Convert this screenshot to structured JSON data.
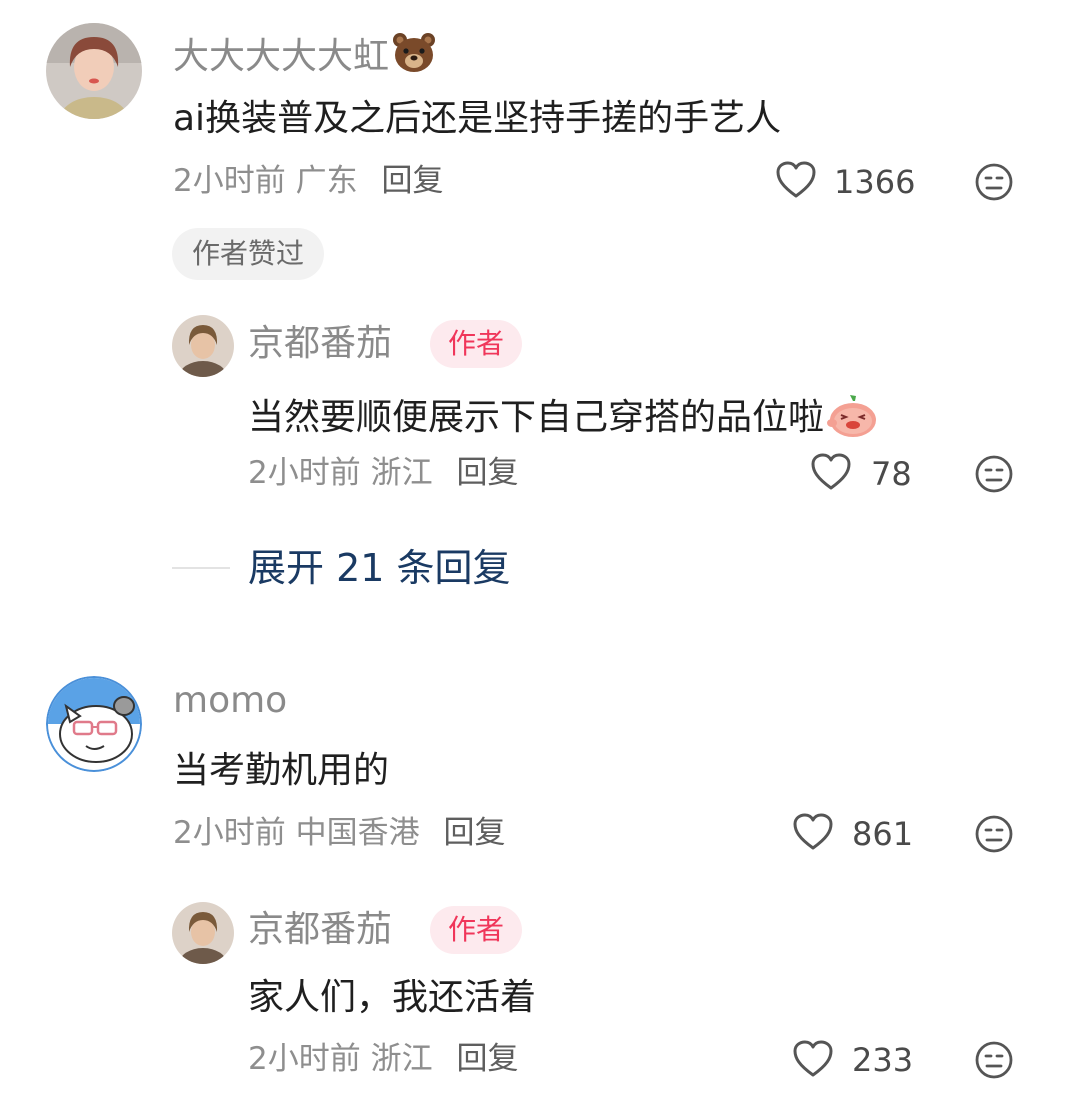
{
  "comments": [
    {
      "user": "大大大大大虹",
      "text": "ai换装普及之后还是坚持手搓的手艺人",
      "time": "2小时前",
      "location": "广东",
      "reply_label": "回复",
      "likes": "1366",
      "tag": "作者赞过",
      "replies": [
        {
          "user": "京都番茄",
          "badge": "作者",
          "text": "当然要顺便展示下自己穿搭的品位啦",
          "time": "2小时前",
          "location": "浙江",
          "reply_label": "回复",
          "likes": "78"
        }
      ],
      "expand_label": "展开 21 条回复"
    },
    {
      "user": "momo",
      "text": "当考勤机用的",
      "time": "2小时前",
      "location": "中国香港",
      "reply_label": "回复",
      "likes": "861",
      "replies": [
        {
          "user": "京都番茄",
          "badge": "作者",
          "text": "家人们，我还活着",
          "time": "2小时前",
          "location": "浙江",
          "reply_label": "回复",
          "likes": "233"
        }
      ]
    }
  ],
  "icons": {
    "like": "heart-outline-icon",
    "dislike": "meh-face-icon",
    "bear": "bear-emoji-icon",
    "tomato": "tomato-emoji-icon"
  },
  "colors": {
    "author_badge_bg": "#fdeaee",
    "author_badge_text": "#f0365a",
    "expand_link": "#1a3a63"
  }
}
